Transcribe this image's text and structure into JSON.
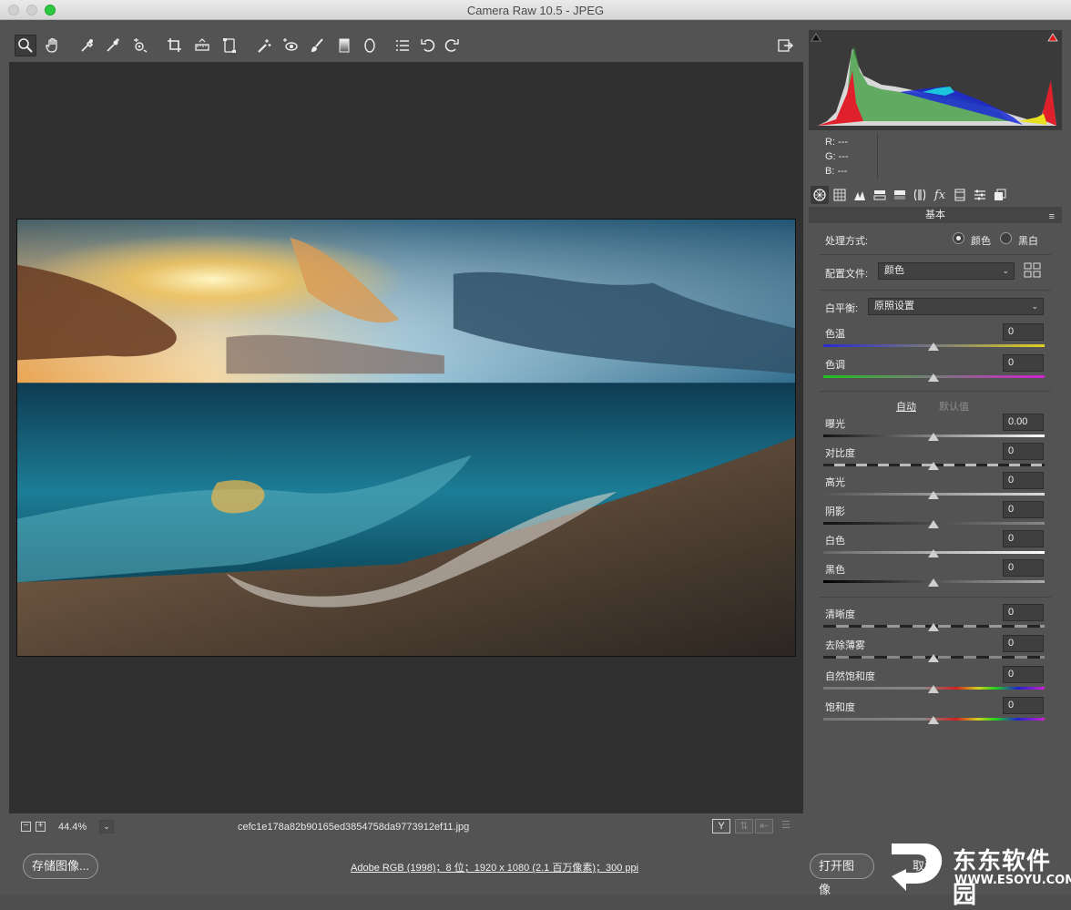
{
  "window": {
    "title": "Camera Raw 10.5 -  JPEG"
  },
  "toolbar": {
    "tools": [
      {
        "name": "zoom-tool",
        "glyph": "🔍"
      },
      {
        "name": "hand-tool",
        "glyph": "✋"
      },
      {
        "name": "white-balance-tool"
      },
      {
        "name": "color-sampler-tool"
      },
      {
        "name": "targeted-adjustment-tool"
      },
      {
        "name": "crop-tool"
      },
      {
        "name": "straighten-tool"
      },
      {
        "name": "transform-tool"
      },
      {
        "name": "spot-removal-tool"
      },
      {
        "name": "red-eye-removal-tool"
      },
      {
        "name": "adjustment-brush-tool"
      },
      {
        "name": "graduated-filter-tool"
      },
      {
        "name": "radial-filter-tool"
      },
      {
        "name": "preferences-tool"
      },
      {
        "name": "rotate-left-tool"
      },
      {
        "name": "rotate-right-tool"
      }
    ]
  },
  "status": {
    "zoom_minus": "−",
    "zoom_plus": "+",
    "zoom": "44.4%",
    "zoom_dropdown": "⌄",
    "filename": "cefc1e178a82b90165ed3854758da9773912ef11.jpg",
    "before_after_label": "Y"
  },
  "histogram": {
    "readout": {
      "r": "R:   ---",
      "g": "G:   ---",
      "b": "B:   ---"
    }
  },
  "panel": {
    "title": "基本",
    "menu_icon": "≡",
    "treatment_label": "处理方式:",
    "treatment_color": "颜色",
    "treatment_bw": "黑白",
    "profile_label": "配置文件:",
    "profile_value": "颜色",
    "wb_label": "白平衡:",
    "wb_value": "原照设置",
    "auto": "自动",
    "default": "默认值",
    "sliders": [
      {
        "label": "色温",
        "value": "0"
      },
      {
        "label": "色调",
        "value": "0"
      },
      {
        "label": "曝光",
        "value": "0.00"
      },
      {
        "label": "对比度",
        "value": "0"
      },
      {
        "label": "高光",
        "value": "0"
      },
      {
        "label": "阴影",
        "value": "0"
      },
      {
        "label": "白色",
        "value": "0"
      },
      {
        "label": "黑色",
        "value": "0"
      },
      {
        "label": "清晰度",
        "value": "0"
      },
      {
        "label": "去除薄雾",
        "value": "0"
      },
      {
        "label": "自然饱和度",
        "value": "0"
      },
      {
        "label": "饱和度",
        "value": "0"
      }
    ]
  },
  "footer": {
    "save": "存储图像...",
    "info": "Adobe RGB (1998)；8 位；1920 x 1080 (2.1 百万像素)；300 ppi",
    "open": "打开图像",
    "cancel": "取消"
  },
  "watermark": {
    "name": "东东软件园",
    "url": "WWW.ESOYU.COM"
  }
}
